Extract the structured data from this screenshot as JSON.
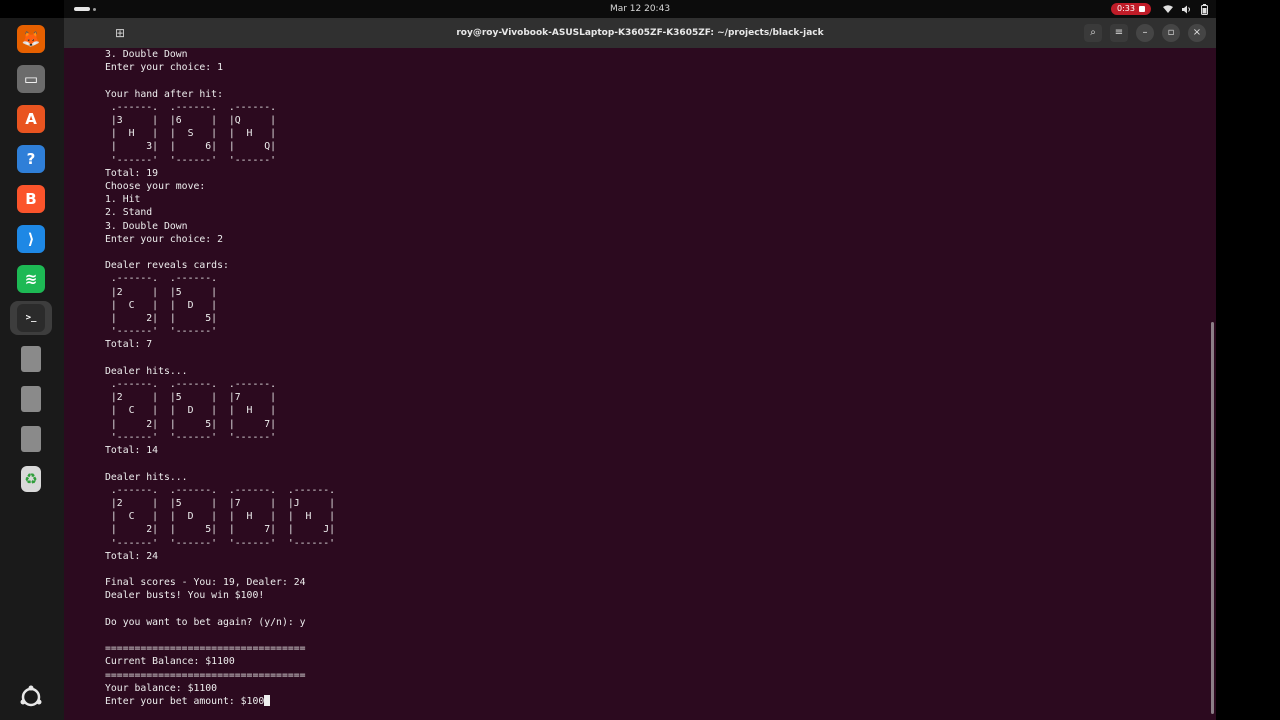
{
  "topbar": {
    "clock": "Mar 12  20:43",
    "recording_time": "0:33",
    "icons": [
      "wifi-icon",
      "volume-icon",
      "battery-icon"
    ]
  },
  "dock": {
    "apps": [
      {
        "name": "firefox-icon",
        "color": "#e66000",
        "glyph": "🦊"
      },
      {
        "name": "files-icon",
        "color": "#6b6b6b",
        "glyph": "▭"
      },
      {
        "name": "app-center-icon",
        "color": "#e95420",
        "glyph": "A"
      },
      {
        "name": "help-icon",
        "color": "#2f7fd8",
        "glyph": "?"
      },
      {
        "name": "brave-icon",
        "color": "#fb542b",
        "glyph": "B"
      },
      {
        "name": "vscode-icon",
        "color": "#1e88e5",
        "glyph": "⟩"
      },
      {
        "name": "spotify-icon",
        "color": "#1db954",
        "glyph": "≋"
      },
      {
        "name": "terminal-icon",
        "color": "#2b2b2b",
        "glyph": ">_"
      },
      {
        "name": "ssd-drive-icon",
        "color": "#8a8a8a",
        "glyph": ""
      },
      {
        "name": "ssd-drive-icon",
        "color": "#8a8a8a",
        "glyph": ""
      },
      {
        "name": "ssd-drive-icon",
        "color": "#8a8a8a",
        "glyph": ""
      },
      {
        "name": "trash-icon",
        "color": "#d9d9d9",
        "glyph": "♻"
      }
    ],
    "show_apps_icon": "ubuntu-logo-icon"
  },
  "window": {
    "title": "roy@roy-Vivobook-ASUSLaptop-K3605ZF-K3605ZF: ~/projects/black-jack"
  },
  "terminal": {
    "lines": [
      "3. Double Down",
      "Enter your choice: 1",
      "",
      "Your hand after hit:",
      " .------.  .------.  .------.",
      " |3     |  |6     |  |Q     |",
      " |  H   |  |  S   |  |  H   |",
      " |     3|  |     6|  |     Q|",
      " '------'  '------'  '------'",
      "Total: 19",
      "Choose your move:",
      "1. Hit",
      "2. Stand",
      "3. Double Down",
      "Enter your choice: 2",
      "",
      "Dealer reveals cards:",
      " .------.  .------.",
      " |2     |  |5     |",
      " |  C   |  |  D   |",
      " |     2|  |     5|",
      " '------'  '------'",
      "Total: 7",
      "",
      "Dealer hits...",
      " .------.  .------.  .------.",
      " |2     |  |5     |  |7     |",
      " |  C   |  |  D   |  |  H   |",
      " |     2|  |     5|  |     7|",
      " '------'  '------'  '------'",
      "Total: 14",
      "",
      "Dealer hits...",
      " .------.  .------.  .------.  .------.",
      " |2     |  |5     |  |7     |  |J     |",
      " |  C   |  |  D   |  |  H   |  |  H   |",
      " |     2|  |     5|  |     7|  |     J|",
      " '------'  '------'  '------'  '------'",
      "Total: 24",
      "",
      "Final scores - You: 19, Dealer: 24",
      "Dealer busts! You win $100!",
      "",
      "Do you want to bet again? (y/n): y",
      "",
      "==================================",
      "Current Balance: $1100",
      "==================================",
      "Your balance: $1100",
      "Enter your bet amount: $100"
    ]
  }
}
